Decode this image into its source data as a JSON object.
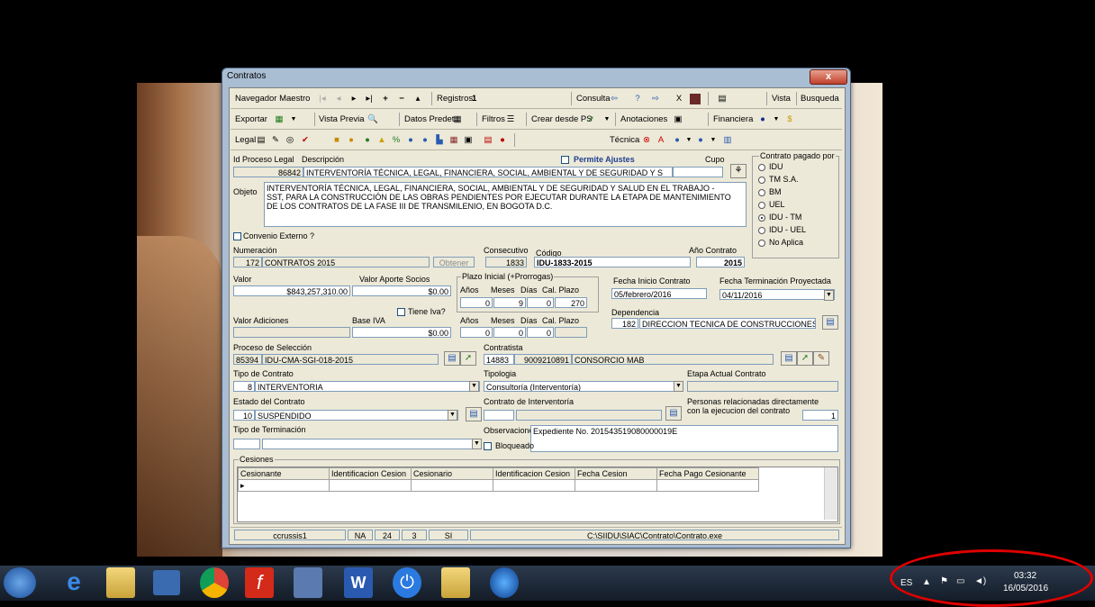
{
  "window": {
    "title": "Contratos",
    "close_label": "x"
  },
  "toolbar1": {
    "navegador": "Navegador Maestro",
    "registros_label": "Registros:",
    "registros_value": "1",
    "consulta": "Consulta",
    "vista": "Vista",
    "busqueda": "Busqueda"
  },
  "toolbar2": {
    "exportar": "Exportar",
    "vista_previa": "Vista Previa",
    "datos_predet": "Datos Predet.",
    "filtros": "Filtros",
    "crear_desde_ps": "Crear desde PS",
    "anotaciones": "Anotaciones",
    "financiera": "Financiera"
  },
  "toolbar3": {
    "legal": "Legal",
    "tecnica": "Técnica"
  },
  "form": {
    "id_proceso_label": "Id Proceso Legal",
    "id_proceso": "86842",
    "descripcion_label": "Descripción",
    "descripcion": "INTERVENTORÍA TÉCNICA, LEGAL, FINANCIERA, SOCIAL, AMBIENTAL Y DE SEGURIDAD  Y S",
    "permite_ajustes": "Permite Ajustes",
    "cupo_label": "Cupo",
    "cupo": "",
    "objeto_label": "Objeto",
    "objeto": "INTERVENTORÍA TÉCNICA, LEGAL, FINANCIERA, SOCIAL, AMBIENTAL Y DE SEGURIDAD  Y SALUD EN EL TRABAJO - SST, PARA LA CONSTRUCCIÓN DE LAS OBRAS PENDIENTES POR EJECUTAR DURANTE LA ETAPA DE MANTENIMIENTO DE LOS CONTRATOS DE LA FASE III DE TRANSMILENIO, EN BOGOTA D.C.",
    "convenio_externo": "Convenio Externo ?",
    "numeracion_label": "Numeración",
    "numeracion_num": "172",
    "numeracion_text": "CONTRATOS 2015",
    "obtener": "Obtener",
    "consecutivo_label": "Consecutivo",
    "consecutivo": "1833",
    "codigo_label": "Código",
    "codigo": "IDU-1833-2015",
    "anio_label": "Año Contrato",
    "anio": "2015",
    "valor_label": "Valor",
    "valor": "$843,257,310.00",
    "valor_aporte_label": "Valor Aporte Socios",
    "valor_aporte": "$0.00",
    "plazo_label": "Plazo Inicial (+Prorrogas)",
    "anios_label": "Años",
    "meses_label": "Meses",
    "dias_label": "Días",
    "cal_plazo_label": "Cal. Plazo",
    "plazo_anios": "0",
    "plazo_meses": "9",
    "plazo_dias": "0",
    "plazo_cal": "270",
    "fecha_inicio_label": "Fecha Inicio Contrato",
    "fecha_inicio": "05/febrero/2016",
    "fecha_term_label": "Fecha Terminación Proyectada",
    "fecha_term": "04/11/2016",
    "tiene_iva": "Tiene Iva?",
    "valor_adiciones_label": "Valor Adiciones",
    "base_iva_label": "Base IVA",
    "base_iva": "$0.00",
    "ad_anios": "0",
    "ad_meses": "0",
    "ad_dias": "0",
    "ad_cal": "",
    "dependencia_label": "Dependencia",
    "dependencia_num": "182",
    "dependencia_text": "DIRECCION TECNICA DE CONSTRUCCIONES",
    "proceso_sel_label": "Proceso de Selección",
    "proceso_sel_num": "85394",
    "proceso_sel_text": "IDU-CMA-SGI-018-2015",
    "contratista_label": "Contratista",
    "contratista_id": "14883",
    "contratista_nit": "9009210891",
    "contratista_nombre": "CONSORCIO MAB",
    "tipo_contrato_label": "Tipo de Contrato",
    "tipo_contrato_num": "8",
    "tipo_contrato": "INTERVENTORIA",
    "tipologia_label": "Tipologia",
    "tipologia": "Consultoría (Interventoría)",
    "etapa_label": "Etapa Actual Contrato",
    "etapa": "",
    "estado_label": "Estado del Contrato",
    "estado_num": "10",
    "estado": "SUSPENDIDO",
    "contrato_interv_label": "Contrato de Interventoría",
    "personas_label1": "Personas relacionadas directamente",
    "personas_label2": "con la ejecucion del contrato",
    "personas": "1",
    "tipo_term_label": "Tipo de Terminación",
    "observaciones_label": "Observaciones",
    "observaciones": "Expediente No. 201543519080000019E",
    "bloqueado": "Bloqueado"
  },
  "contrato_pagado": {
    "title": "Contrato pagado por",
    "options": [
      "IDU",
      "TM S.A.",
      "BM",
      "UEL",
      "IDU - TM",
      "IDU - UEL",
      "No Aplica"
    ],
    "selected": "IDU - TM"
  },
  "cesiones": {
    "title": "Cesiones",
    "columns": [
      "Cesionante",
      "Identificacion Cesion",
      "Cesionario",
      "Identificacion Cesion",
      "Fecha Cesion",
      "Fecha Pago Cesionante"
    ]
  },
  "statusbar": {
    "user": "ccrussis1",
    "f1": "NA",
    "f2": "24",
    "f3": "3",
    "f4": "SI",
    "path": "C:\\SIIDU\\SIAC\\Contrato\\Contrato.exe"
  },
  "tray": {
    "lang": "ES",
    "time": "03:32",
    "date": "16/05/2016"
  },
  "colors": {
    "highlight_circle": "#e00000",
    "title_blue": "#1f3f8f"
  }
}
